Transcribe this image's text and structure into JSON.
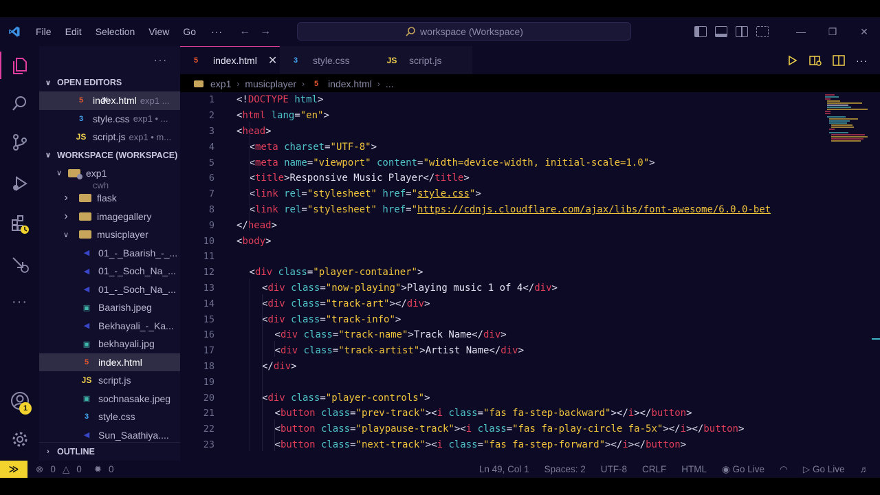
{
  "menu": [
    "File",
    "Edit",
    "Selection",
    "View",
    "Go"
  ],
  "menu_more": "···",
  "command_center": "workspace (Workspace)",
  "sidebar": {
    "more": "···",
    "open_editors_title": "OPEN EDITORS",
    "open_editors": [
      {
        "name": "index.html",
        "detail": "exp1 ...",
        "icon": "html-icon",
        "glyph": "5",
        "selected": true
      },
      {
        "name": "style.css",
        "detail": "exp1 • ...",
        "icon": "css-icon",
        "glyph": "3",
        "selected": false
      },
      {
        "name": "script.js",
        "detail": "exp1 • m...",
        "icon": "js-icon",
        "glyph": "JS",
        "selected": false
      }
    ],
    "workspace_title": "WORKSPACE (WORKSPACE)",
    "root_folder": "exp1",
    "partial_item": "cwh",
    "folders": [
      "flask",
      "imagegallery",
      "musicplayer"
    ],
    "files": [
      {
        "name": "01_-_Baarish_-_...",
        "icon": "audio-icon",
        "glyph": "◀"
      },
      {
        "name": "01_-_Soch_Na_...",
        "icon": "audio-icon",
        "glyph": "◀"
      },
      {
        "name": "01_-_Soch_Na_...",
        "icon": "audio-icon",
        "glyph": "◀"
      },
      {
        "name": "Baarish.jpeg",
        "icon": "image-icon",
        "glyph": "▣"
      },
      {
        "name": "Bekhayali_-_Ka...",
        "icon": "audio-icon",
        "glyph": "◀"
      },
      {
        "name": "bekhayali.jpg",
        "icon": "image-icon",
        "glyph": "▣"
      },
      {
        "name": "index.html",
        "icon": "html-icon",
        "glyph": "5",
        "selected": true
      },
      {
        "name": "script.js",
        "icon": "js-icon",
        "glyph": "JS"
      },
      {
        "name": "sochnasake.jpeg",
        "icon": "image-icon",
        "glyph": "▣"
      },
      {
        "name": "style.css",
        "icon": "css-icon",
        "glyph": "3"
      },
      {
        "name": "Sun_Saathiya....",
        "icon": "audio-icon",
        "glyph": "◀"
      }
    ],
    "outline_title": "OUTLINE"
  },
  "tabs": [
    {
      "label": "index.html",
      "icon": "html-icon",
      "glyph": "5",
      "active": true,
      "close": "✕"
    },
    {
      "label": "style.css",
      "icon": "css-icon",
      "glyph": "3",
      "active": false
    },
    {
      "label": "script.js",
      "icon": "js-icon",
      "glyph": "JS",
      "active": false
    }
  ],
  "breadcrumb": [
    "exp1",
    "musicplayer",
    "index.html",
    "..."
  ],
  "code_lines": [
    {
      "n": "1",
      "indent": 0,
      "tokens": [
        [
          "punc",
          "<!"
        ],
        [
          "tag",
          "DOCTYPE"
        ],
        [
          "punc",
          " "
        ],
        [
          "attr",
          "html"
        ],
        [
          "punc",
          ">"
        ]
      ]
    },
    {
      "n": "2",
      "indent": 0,
      "tokens": [
        [
          "punc",
          "<"
        ],
        [
          "tag",
          "html"
        ],
        [
          "punc",
          " "
        ],
        [
          "attr",
          "lang"
        ],
        [
          "punc",
          "="
        ],
        [
          "str",
          "\"en\""
        ],
        [
          "punc",
          ">"
        ]
      ]
    },
    {
      "n": "3",
      "indent": 0,
      "tokens": [
        [
          "punc",
          "<"
        ],
        [
          "tag",
          "head"
        ],
        [
          "punc",
          ">"
        ]
      ]
    },
    {
      "n": "4",
      "indent": 1,
      "tokens": [
        [
          "punc",
          "<"
        ],
        [
          "tag",
          "meta"
        ],
        [
          "punc",
          " "
        ],
        [
          "attr",
          "charset"
        ],
        [
          "punc",
          "="
        ],
        [
          "str",
          "\"UTF-8\""
        ],
        [
          "punc",
          ">"
        ]
      ]
    },
    {
      "n": "5",
      "indent": 1,
      "tokens": [
        [
          "punc",
          "<"
        ],
        [
          "tag",
          "meta"
        ],
        [
          "punc",
          " "
        ],
        [
          "attr",
          "name"
        ],
        [
          "punc",
          "="
        ],
        [
          "str",
          "\"viewport\""
        ],
        [
          "punc",
          " "
        ],
        [
          "attr",
          "content"
        ],
        [
          "punc",
          "="
        ],
        [
          "str",
          "\"width=device-width, initial-scale=1.0\""
        ],
        [
          "punc",
          ">"
        ]
      ]
    },
    {
      "n": "6",
      "indent": 1,
      "tokens": [
        [
          "punc",
          "<"
        ],
        [
          "tag",
          "title"
        ],
        [
          "punc",
          ">Responsive Music Player</"
        ],
        [
          "tag",
          "title"
        ],
        [
          "punc",
          ">"
        ]
      ]
    },
    {
      "n": "7",
      "indent": 1,
      "tokens": [
        [
          "punc",
          "<"
        ],
        [
          "tag",
          "link"
        ],
        [
          "punc",
          " "
        ],
        [
          "attr",
          "rel"
        ],
        [
          "punc",
          "="
        ],
        [
          "str",
          "\"stylesheet\""
        ],
        [
          "punc",
          " "
        ],
        [
          "attr",
          "href"
        ],
        [
          "punc",
          "="
        ],
        [
          "str",
          "\""
        ],
        [
          "link",
          "style.css"
        ],
        [
          "str",
          "\""
        ],
        [
          "punc",
          ">"
        ]
      ]
    },
    {
      "n": "8",
      "indent": 1,
      "tokens": [
        [
          "punc",
          "<"
        ],
        [
          "tag",
          "link"
        ],
        [
          "punc",
          " "
        ],
        [
          "attr",
          "rel"
        ],
        [
          "punc",
          "="
        ],
        [
          "str",
          "\"stylesheet\""
        ],
        [
          "punc",
          " "
        ],
        [
          "attr",
          "href"
        ],
        [
          "punc",
          "="
        ],
        [
          "str",
          "\""
        ],
        [
          "link",
          "https://cdnjs.cloudflare.com/ajax/libs/font-awesome/6.0.0-bet"
        ]
      ]
    },
    {
      "n": "9",
      "indent": 0,
      "tokens": [
        [
          "punc",
          "</"
        ],
        [
          "tag",
          "head"
        ],
        [
          "punc",
          ">"
        ]
      ]
    },
    {
      "n": "10",
      "indent": 0,
      "tokens": [
        [
          "punc",
          "<"
        ],
        [
          "tag",
          "body"
        ],
        [
          "punc",
          ">"
        ]
      ]
    },
    {
      "n": "11",
      "indent": 0,
      "tokens": []
    },
    {
      "n": "12",
      "indent": 1,
      "tokens": [
        [
          "punc",
          "<"
        ],
        [
          "tag",
          "div"
        ],
        [
          "punc",
          " "
        ],
        [
          "attr",
          "class"
        ],
        [
          "punc",
          "="
        ],
        [
          "str",
          "\"player-container\""
        ],
        [
          "punc",
          ">"
        ]
      ]
    },
    {
      "n": "13",
      "indent": 2,
      "tokens": [
        [
          "punc",
          "<"
        ],
        [
          "tag",
          "div"
        ],
        [
          "punc",
          " "
        ],
        [
          "attr",
          "class"
        ],
        [
          "punc",
          "="
        ],
        [
          "str",
          "\"now-playing\""
        ],
        [
          "punc",
          ">Playing music 1 of 4</"
        ],
        [
          "tag",
          "div"
        ],
        [
          "punc",
          ">"
        ]
      ]
    },
    {
      "n": "14",
      "indent": 2,
      "tokens": [
        [
          "punc",
          "<"
        ],
        [
          "tag",
          "div"
        ],
        [
          "punc",
          " "
        ],
        [
          "attr",
          "class"
        ],
        [
          "punc",
          "="
        ],
        [
          "str",
          "\"track-art\""
        ],
        [
          "punc",
          "></"
        ],
        [
          "tag",
          "div"
        ],
        [
          "punc",
          ">"
        ]
      ]
    },
    {
      "n": "15",
      "indent": 2,
      "tokens": [
        [
          "punc",
          "<"
        ],
        [
          "tag",
          "div"
        ],
        [
          "punc",
          " "
        ],
        [
          "attr",
          "class"
        ],
        [
          "punc",
          "="
        ],
        [
          "str",
          "\"track-info\""
        ],
        [
          "punc",
          ">"
        ]
      ]
    },
    {
      "n": "16",
      "indent": 3,
      "tokens": [
        [
          "punc",
          "<"
        ],
        [
          "tag",
          "div"
        ],
        [
          "punc",
          " "
        ],
        [
          "attr",
          "class"
        ],
        [
          "punc",
          "="
        ],
        [
          "str",
          "\"track-name\""
        ],
        [
          "punc",
          ">Track Name</"
        ],
        [
          "tag",
          "div"
        ],
        [
          "punc",
          ">"
        ]
      ]
    },
    {
      "n": "17",
      "indent": 3,
      "tokens": [
        [
          "punc",
          "<"
        ],
        [
          "tag",
          "div"
        ],
        [
          "punc",
          " "
        ],
        [
          "attr",
          "class"
        ],
        [
          "punc",
          "="
        ],
        [
          "str",
          "\"track-artist\""
        ],
        [
          "punc",
          ">Artist Name</"
        ],
        [
          "tag",
          "div"
        ],
        [
          "punc",
          ">"
        ]
      ]
    },
    {
      "n": "18",
      "indent": 2,
      "tokens": [
        [
          "punc",
          "</"
        ],
        [
          "tag",
          "div"
        ],
        [
          "punc",
          ">"
        ]
      ]
    },
    {
      "n": "19",
      "indent": 0,
      "tokens": []
    },
    {
      "n": "20",
      "indent": 2,
      "tokens": [
        [
          "punc",
          "<"
        ],
        [
          "tag",
          "div"
        ],
        [
          "punc",
          " "
        ],
        [
          "attr",
          "class"
        ],
        [
          "punc",
          "="
        ],
        [
          "str",
          "\"player-controls\""
        ],
        [
          "punc",
          ">"
        ]
      ]
    },
    {
      "n": "21",
      "indent": 3,
      "tokens": [
        [
          "punc",
          "<"
        ],
        [
          "tag",
          "button"
        ],
        [
          "punc",
          " "
        ],
        [
          "attr",
          "class"
        ],
        [
          "punc",
          "="
        ],
        [
          "str",
          "\"prev-track\""
        ],
        [
          "punc",
          "><"
        ],
        [
          "tag",
          "i"
        ],
        [
          "punc",
          " "
        ],
        [
          "attr",
          "class"
        ],
        [
          "punc",
          "="
        ],
        [
          "str",
          "\"fas fa-step-backward\""
        ],
        [
          "punc",
          "></"
        ],
        [
          "tag",
          "i"
        ],
        [
          "punc",
          "></"
        ],
        [
          "tag",
          "button"
        ],
        [
          "punc",
          ">"
        ]
      ]
    },
    {
      "n": "22",
      "indent": 3,
      "tokens": [
        [
          "punc",
          "<"
        ],
        [
          "tag",
          "button"
        ],
        [
          "punc",
          " "
        ],
        [
          "attr",
          "class"
        ],
        [
          "punc",
          "="
        ],
        [
          "str",
          "\"playpause-track\""
        ],
        [
          "punc",
          "><"
        ],
        [
          "tag",
          "i"
        ],
        [
          "punc",
          " "
        ],
        [
          "attr",
          "class"
        ],
        [
          "punc",
          "="
        ],
        [
          "str",
          "\"fas fa-play-circle fa-5x\""
        ],
        [
          "punc",
          "></"
        ],
        [
          "tag",
          "i"
        ],
        [
          "punc",
          "></"
        ],
        [
          "tag",
          "button"
        ],
        [
          "punc",
          ">"
        ]
      ]
    },
    {
      "n": "23",
      "indent": 3,
      "tokens": [
        [
          "punc",
          "<"
        ],
        [
          "tag",
          "button"
        ],
        [
          "punc",
          " "
        ],
        [
          "attr",
          "class"
        ],
        [
          "punc",
          "="
        ],
        [
          "str",
          "\"next-track\""
        ],
        [
          "punc",
          "><"
        ],
        [
          "tag",
          "i"
        ],
        [
          "punc",
          " "
        ],
        [
          "attr",
          "class"
        ],
        [
          "punc",
          "="
        ],
        [
          "str",
          "\"fas fa-step-forward\""
        ],
        [
          "punc",
          "></"
        ],
        [
          "tag",
          "i"
        ],
        [
          "punc",
          "></"
        ],
        [
          "tag",
          "button"
        ],
        [
          "punc",
          ">"
        ]
      ]
    }
  ],
  "status": {
    "remote": "≫",
    "errors": "0",
    "warnings": "0",
    "ports": "0",
    "position": "Ln 49, Col 1",
    "spaces": "Spaces: 2",
    "encoding": "UTF-8",
    "eol": "CRLF",
    "language": "HTML",
    "golive1": "Go Live",
    "golive2": "Go Live"
  },
  "badge": "1",
  "colors": {
    "accent": "#e13ea0",
    "tag": "#e13e5a",
    "attr": "#4fc3c9",
    "string": "#f0c33c",
    "background": "#0c0a24",
    "sidebar": "#110e2b"
  }
}
